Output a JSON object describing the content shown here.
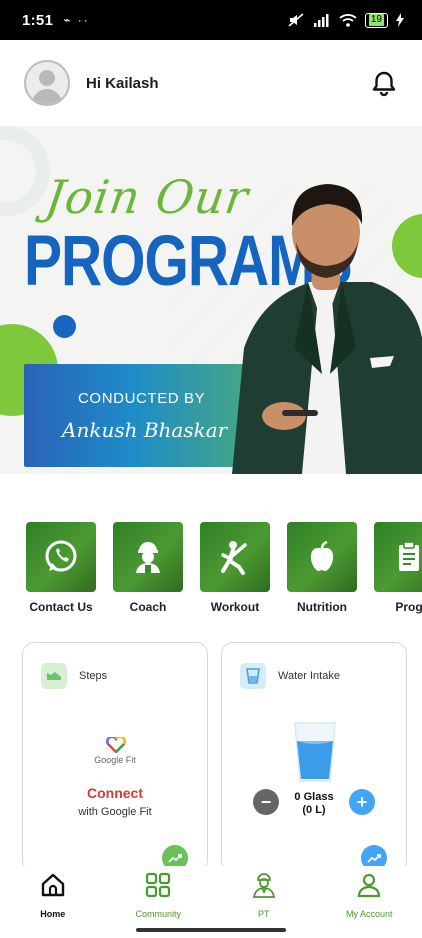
{
  "status_bar": {
    "time": "1:51",
    "left_indicators": "⌁ ··",
    "battery": "19"
  },
  "header": {
    "greeting": "Hi Kailash",
    "avatar_icon": "user-avatar-icon",
    "bell_icon": "bell-icon"
  },
  "banner": {
    "headline_script": "Join Our",
    "headline": "PROGRAMS",
    "conducted_by": "CONDUCTED BY",
    "conductor_name": "Ankush Bhaskar"
  },
  "quick_actions": [
    {
      "label": "Contact Us",
      "icon": "whatsapp-icon"
    },
    {
      "label": "Coach",
      "icon": "coach-icon"
    },
    {
      "label": "Workout",
      "icon": "workout-icon"
    },
    {
      "label": "Nutrition",
      "icon": "apple-icon"
    },
    {
      "label": "Prog",
      "icon": "clipboard-icon"
    }
  ],
  "steps_card": {
    "title": "Steps",
    "fit_brand": "Google Fit",
    "connect": "Connect",
    "with_text": "with Google Fit"
  },
  "water_card": {
    "title": "Water Intake",
    "glass_count": "0 Glass",
    "litres": "(0 L)"
  },
  "bottom_nav": [
    {
      "label": "Home",
      "icon": "home-icon",
      "active": true
    },
    {
      "label": "Community",
      "icon": "community-icon",
      "active": false
    },
    {
      "label": "PT",
      "icon": "personal-trainer-icon",
      "active": false
    },
    {
      "label": "My Account",
      "icon": "account-icon",
      "active": false
    }
  ],
  "colors": {
    "brand_green": "#4c9a32",
    "brand_blue": "#1565c0",
    "connect_red": "#d53b35",
    "water_blue": "#42a5f5"
  }
}
